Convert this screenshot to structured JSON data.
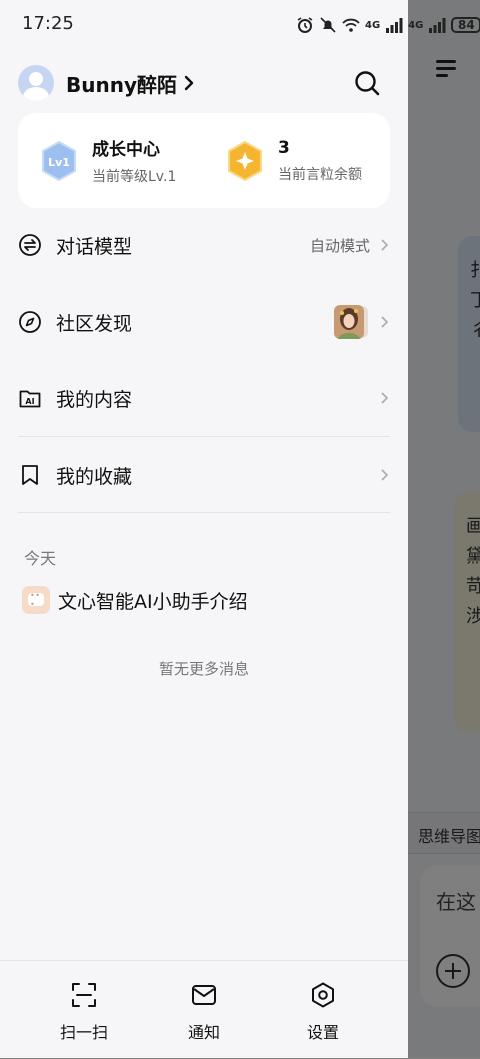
{
  "status_bar": {
    "time": "17:25",
    "network_1": "4G",
    "network_2": "4G",
    "battery": "84"
  },
  "profile": {
    "username": "Bunny醉陌"
  },
  "growth": {
    "center_title": "成长中心",
    "level_badge": "Lv1",
    "level_sub": "当前等级Lv.1",
    "coin_count": "3",
    "coin_sub": "当前言粒余额"
  },
  "menu": [
    {
      "label": "对话模型",
      "value": "自动模式"
    },
    {
      "label": "社区发现",
      "value": ""
    },
    {
      "label": "我的内容",
      "value": ""
    },
    {
      "label": "我的收藏",
      "value": ""
    }
  ],
  "history": {
    "section_today": "今天",
    "items": [
      {
        "title": "文心智能AI小助手介绍"
      }
    ],
    "empty_hint": "暂无更多消息"
  },
  "bottom_bar": {
    "scan": "扫一扫",
    "notify": "通知",
    "settings": "设置"
  },
  "background": {
    "card1_text": "扌 丁 彳",
    "card2_text": "画 黛 苛 涉",
    "strip_text": "思维导图",
    "input_text": "在这"
  },
  "colors": {
    "accent_gold": "#f6b531",
    "level_blue": "#9cbff0",
    "drawer_bg": "#f6f6f8"
  }
}
